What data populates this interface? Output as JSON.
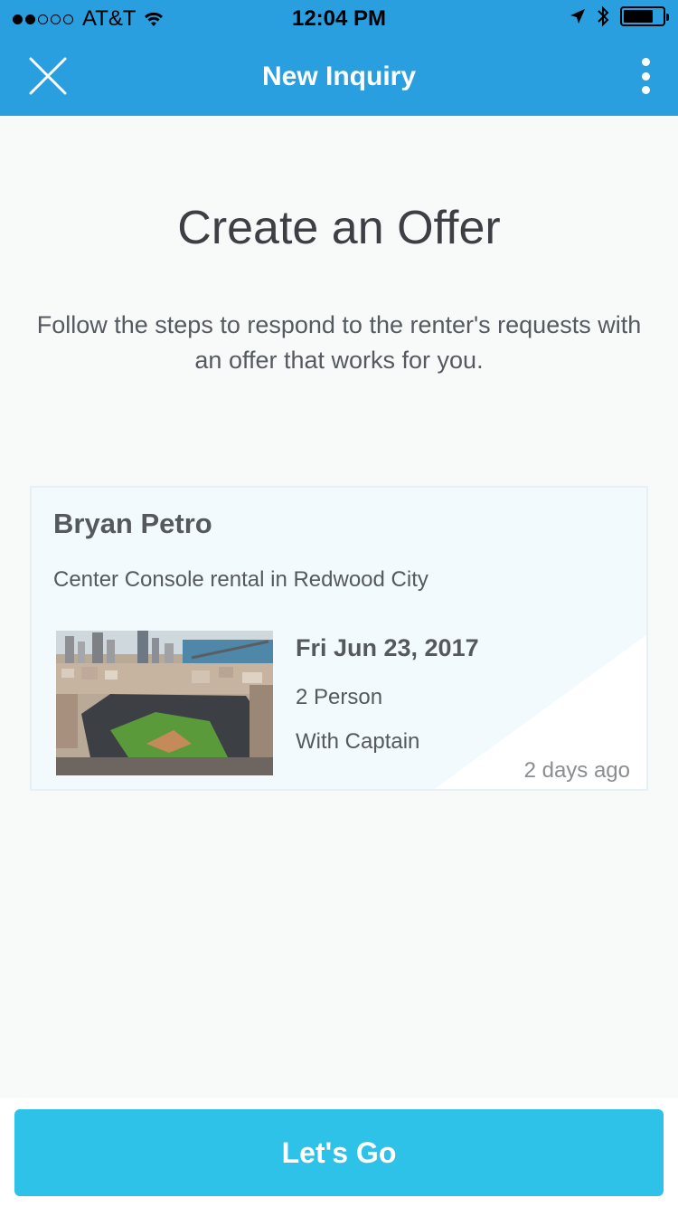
{
  "status_bar": {
    "carrier": "AT&T",
    "time": "12:04 PM",
    "signal_filled": 2,
    "signal_total": 5,
    "battery_level": 0.75
  },
  "nav": {
    "title": "New Inquiry",
    "close_icon": "close-icon",
    "more_icon": "more-vertical-icon"
  },
  "main": {
    "heading": "Create an Offer",
    "subtext": "Follow the steps to respond to the renter's requests with an offer that works for you."
  },
  "inquiry": {
    "renter_name": "Bryan Petro",
    "description": "Center Console rental in Redwood City",
    "date": "Fri Jun 23, 2017",
    "party_size": "2 Person",
    "captain": "With Captain",
    "received": "2 days ago"
  },
  "footer": {
    "cta_label": "Let's Go"
  },
  "colors": {
    "header": "#2a9fe0",
    "cta": "#2ec2e8",
    "card_bg": "#f3fafd"
  }
}
